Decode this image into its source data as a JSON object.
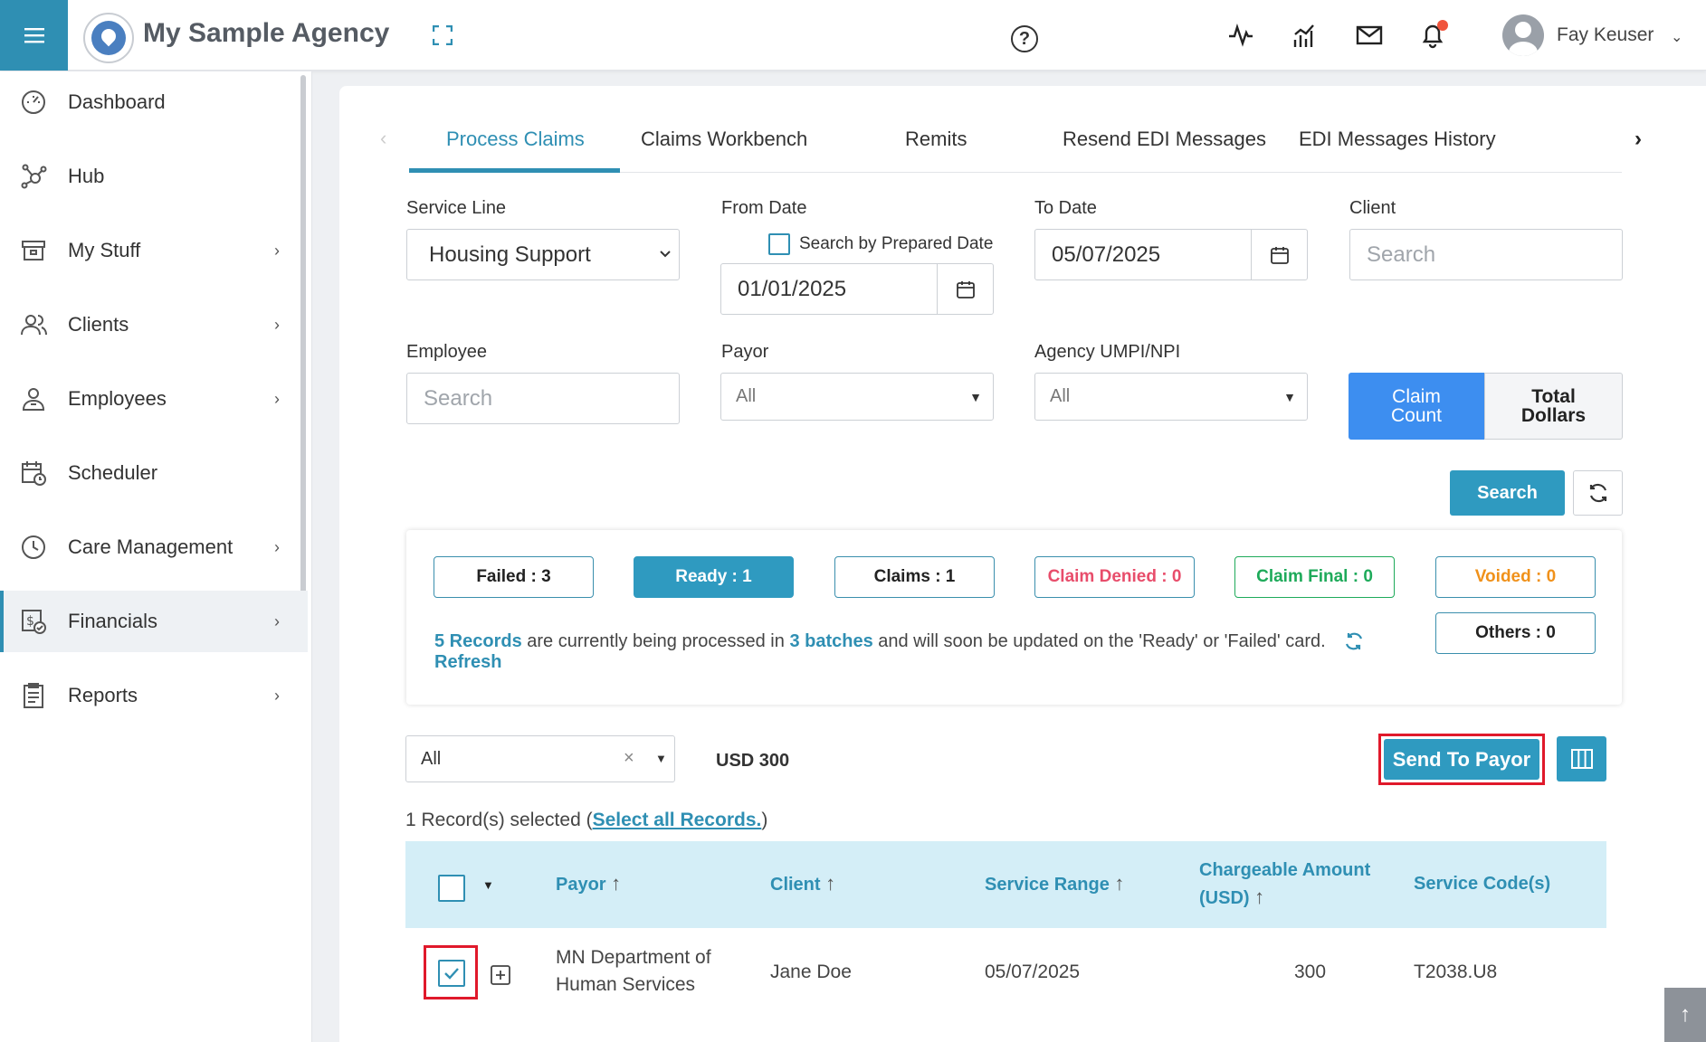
{
  "header": {
    "agency_name": "My Sample Agency",
    "user_name": "Fay Keuser",
    "help_symbol": "?",
    "icons": [
      "menu-icon",
      "agency-logo",
      "fullscreen-icon",
      "help-icon",
      "activity-icon",
      "analytics-icon",
      "mail-icon",
      "bell-icon",
      "avatar"
    ]
  },
  "sidebar": {
    "items": [
      {
        "label": "Dashboard",
        "icon": "dashboard-icon"
      },
      {
        "label": "Hub",
        "icon": "hub-icon"
      },
      {
        "label": "My Stuff",
        "icon": "my-stuff-icon"
      },
      {
        "label": "Clients",
        "icon": "clients-icon"
      },
      {
        "label": "Employees",
        "icon": "employees-icon"
      },
      {
        "label": "Scheduler",
        "icon": "scheduler-icon"
      },
      {
        "label": "Care Management",
        "icon": "care-management-icon"
      },
      {
        "label": "Financials",
        "icon": "financials-icon"
      },
      {
        "label": "Reports",
        "icon": "reports-icon"
      }
    ],
    "active": "Financials"
  },
  "tabs": [
    {
      "label": "Process Claims"
    },
    {
      "label": "Claims Workbench"
    },
    {
      "label": "Remits"
    },
    {
      "label": "Resend EDI Messages"
    },
    {
      "label": "EDI Messages History"
    }
  ],
  "filters": {
    "service_line_label": "Service Line",
    "service_line_value": "Housing Support",
    "from_date_label": "From Date",
    "prepared_date_label": "Search by Prepared Date",
    "from_date_value": "01/01/2025",
    "to_date_label": "To Date",
    "to_date_value": "05/07/2025",
    "client_label": "Client",
    "client_placeholder": "Search",
    "employee_label": "Employee",
    "employee_placeholder": "Search",
    "payor_label": "Payor",
    "payor_value": "All",
    "umpi_label": "Agency UMPI/NPI",
    "umpi_value": "All",
    "claim_count_l1": "Claim",
    "claim_count_l2": "Count",
    "total_dollars_l1": "Total",
    "total_dollars_l2": "Dollars",
    "search_button": "Search"
  },
  "status": {
    "failed": "Failed : 3",
    "ready": "Ready : 1",
    "claims": "Claims : 1",
    "denied": "Claim Denied : 0",
    "final": "Claim Final : 0",
    "voided": "Voided : 0",
    "others": "Others : 0",
    "info_records": "5 Records",
    "info_mid": " are currently being processed in ",
    "info_batches": "3 batches",
    "info_tail": " and will soon be updated on the 'Ready' or 'Failed' card.",
    "refresh_link": "Refresh"
  },
  "toolbar": {
    "filter_value": "All",
    "clear_symbol": "×",
    "total": "USD 300",
    "send_button": "Send To Payor"
  },
  "selection": {
    "text": "1 Record(s) selected (",
    "link": "Select all Records.",
    "close": ")"
  },
  "table": {
    "headers": {
      "payor": "Payor",
      "client": "Client",
      "service_range": "Service Range",
      "amount_l1": "Chargeable Amount",
      "amount_l2": "(USD)",
      "service_codes": "Service Code(s)"
    },
    "rows": [
      {
        "payor_l1": "MN Department of",
        "payor_l2": "Human Services",
        "client": "Jane Doe",
        "service_range": "05/07/2025",
        "amount": "300",
        "service_codes": "T2038.U8",
        "checked": true
      }
    ]
  },
  "colors": {
    "primary": "#2f9ac0",
    "accent_blue": "#3d8ef0",
    "highlight_red": "#e0192b",
    "denied": "#e84d6b",
    "final": "#1eaa5a",
    "voided": "#f0911a"
  }
}
